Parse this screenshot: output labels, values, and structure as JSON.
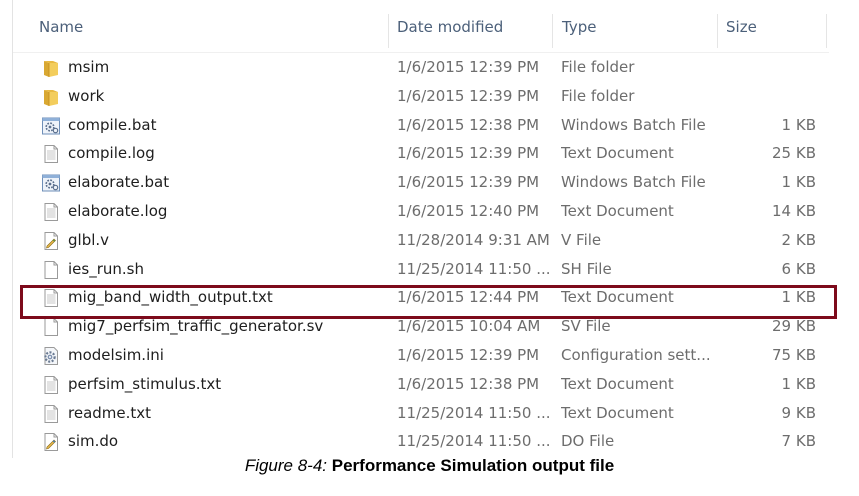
{
  "columns": {
    "name": "Name",
    "date": "Date modified",
    "type": "Type",
    "size": "Size"
  },
  "files": [
    {
      "name": "msim",
      "date": "1/6/2015 12:39 PM",
      "type": "File folder",
      "size": "",
      "icon": "folder-icon"
    },
    {
      "name": "work",
      "date": "1/6/2015 12:39 PM",
      "type": "File folder",
      "size": "",
      "icon": "folder-icon"
    },
    {
      "name": "compile.bat",
      "date": "1/6/2015 12:38 PM",
      "type": "Windows Batch File",
      "size": "1 KB",
      "icon": "batch-file-icon"
    },
    {
      "name": "compile.log",
      "date": "1/6/2015 12:39 PM",
      "type": "Text Document",
      "size": "25 KB",
      "icon": "text-document-icon"
    },
    {
      "name": "elaborate.bat",
      "date": "1/6/2015 12:39 PM",
      "type": "Windows Batch File",
      "size": "1 KB",
      "icon": "batch-file-icon"
    },
    {
      "name": "elaborate.log",
      "date": "1/6/2015 12:40 PM",
      "type": "Text Document",
      "size": "14 KB",
      "icon": "text-document-icon"
    },
    {
      "name": "glbl.v",
      "date": "11/28/2014 9:31 AM",
      "type": "V File",
      "size": "2 KB",
      "icon": "v-file-icon"
    },
    {
      "name": "ies_run.sh",
      "date": "11/25/2014 11:50 ...",
      "type": "SH File",
      "size": "6 KB",
      "icon": "blank-file-icon"
    },
    {
      "name": "mig_band_width_output.txt",
      "date": "1/6/2015 12:44 PM",
      "type": "Text Document",
      "size": "1 KB",
      "icon": "text-document-icon"
    },
    {
      "name": "mig7_perfsim_traffic_generator.sv",
      "date": "1/6/2015 10:04 AM",
      "type": "SV File",
      "size": "29 KB",
      "icon": "blank-file-icon"
    },
    {
      "name": "modelsim.ini",
      "date": "1/6/2015 12:39 PM",
      "type": "Configuration sett...",
      "size": "75 KB",
      "icon": "config-file-icon"
    },
    {
      "name": "perfsim_stimulus.txt",
      "date": "1/6/2015 12:38 PM",
      "type": "Text Document",
      "size": "1 KB",
      "icon": "text-document-icon"
    },
    {
      "name": "readme.txt",
      "date": "11/25/2014 11:50 ...",
      "type": "Text Document",
      "size": "9 KB",
      "icon": "text-document-icon"
    },
    {
      "name": "sim.do",
      "date": "11/25/2014 11:50 ...",
      "type": "DO File",
      "size": "7 KB",
      "icon": "do-file-icon"
    }
  ],
  "highlighted_file": "mig_band_width_output.txt",
  "highlight_color": "#7d0a1b",
  "caption": {
    "figure": "Figure 8-4:",
    "title": "Performance Simulation output file"
  }
}
